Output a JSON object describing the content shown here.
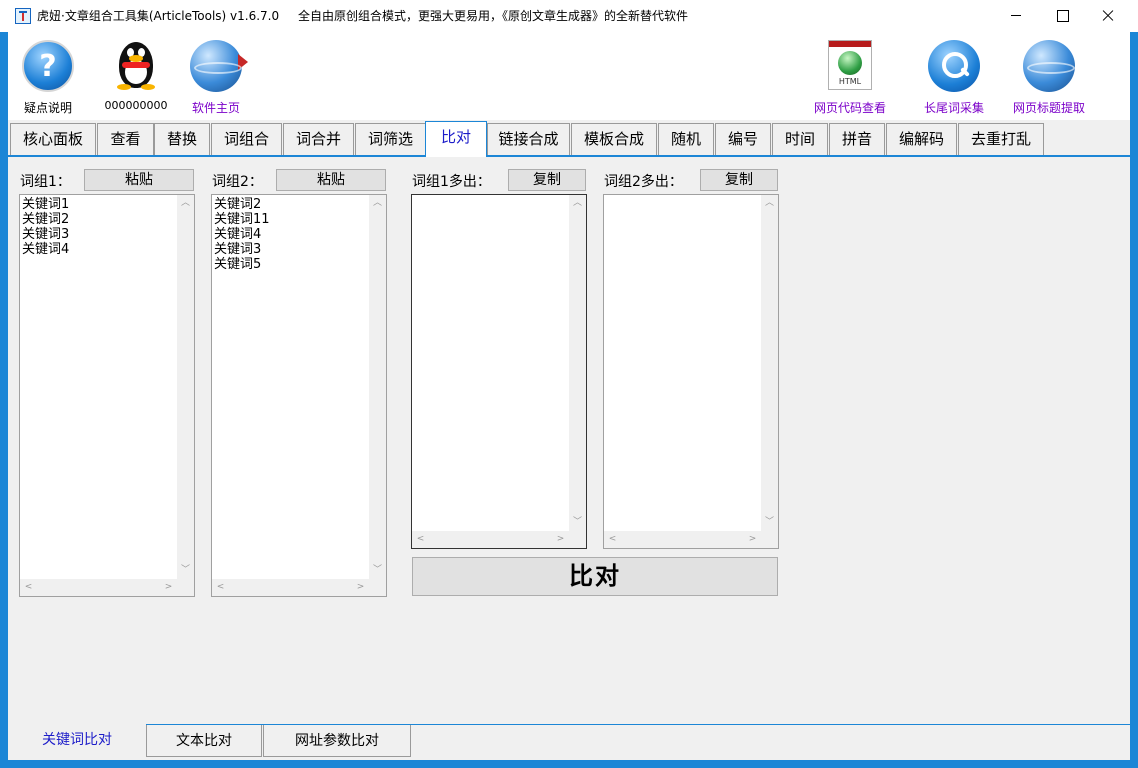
{
  "window": {
    "title": "虎妞·文章组合工具集(ArticleTools) v1.6.7.0",
    "subtitle": "全自由原创组合模式，更强大更易用，《原创文章生成器》的全新替代软件"
  },
  "toolbar": {
    "help": {
      "label": "疑点说明",
      "icon": "help-icon",
      "glyph": "?"
    },
    "qq": {
      "label": "000000000",
      "icon": "qq-penguin-icon"
    },
    "homepage": {
      "label": "软件主页",
      "icon": "globe-icon"
    },
    "html_viewer": {
      "label": "网页代码查看",
      "icon": "html-document-icon",
      "icon_text": "HTML"
    },
    "longtail": {
      "label": "长尾词采集",
      "icon": "search-icon"
    },
    "title_extract": {
      "label": "网页标题提取",
      "icon": "globe-icon"
    }
  },
  "tabs": [
    {
      "label": "核心面板"
    },
    {
      "label": "查看"
    },
    {
      "label": "替换"
    },
    {
      "label": "词组合"
    },
    {
      "label": "词合并"
    },
    {
      "label": "词筛选"
    },
    {
      "label": "比对",
      "active": true
    },
    {
      "label": "链接合成"
    },
    {
      "label": "模板合成"
    },
    {
      "label": "随机"
    },
    {
      "label": "编号"
    },
    {
      "label": "时间"
    },
    {
      "label": "拼音"
    },
    {
      "label": "编解码"
    },
    {
      "label": "去重打乱"
    }
  ],
  "compare": {
    "group1": {
      "label": "词组1：",
      "button": "粘贴",
      "items": [
        "关键词1",
        "关键词2",
        "关键词3",
        "关键词4"
      ]
    },
    "group2": {
      "label": "词组2：",
      "button": "粘贴",
      "items": [
        "关键词2",
        "关键词11",
        "关键词4",
        "关键词3",
        "关键词5"
      ]
    },
    "group1_extra": {
      "label": "词组1多出：",
      "button": "复制",
      "items": []
    },
    "group2_extra": {
      "label": "词组2多出：",
      "button": "复制",
      "items": []
    },
    "compare_button": "比对"
  },
  "bottom_tabs": [
    {
      "label": "关键词比对",
      "active": true
    },
    {
      "label": "文本比对"
    },
    {
      "label": "网址参数比对"
    }
  ],
  "scroll_glyphs": {
    "up": "︿",
    "down": "﹀",
    "left": "<",
    "right": ">"
  },
  "colors": {
    "accent": "#1c86d6",
    "active_tab_text": "#1c1cc9",
    "toolbar_link": "#7b00c9"
  }
}
